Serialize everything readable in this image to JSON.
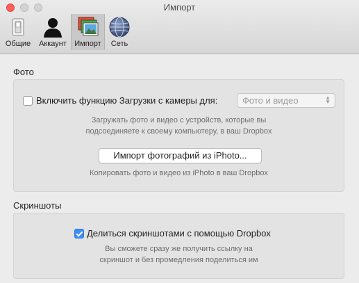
{
  "window": {
    "title": "Импорт"
  },
  "toolbar": {
    "tabs": [
      {
        "label": "Общие",
        "icon": "switch-icon",
        "selected": false
      },
      {
        "label": "Аккаунт",
        "icon": "user-silhouette-icon",
        "selected": false
      },
      {
        "label": "Импорт",
        "icon": "photos-stack-icon",
        "selected": true
      },
      {
        "label": "Сеть",
        "icon": "globe-icon",
        "selected": false
      }
    ]
  },
  "photos_section": {
    "title": "Фото",
    "camera_upload": {
      "checked": false,
      "label": "Включить функцию Загрузки с камеры для:",
      "select_value": "Фото и видео",
      "hint_line1": "Загружать фото и видео с устройств, которые вы",
      "hint_line2": "подсоединяете к своему компьютеру, в ваш Dropbox"
    },
    "iphoto": {
      "button_label": "Импорт фотографий из iPhoto...",
      "hint": "Копировать фото и видео из iPhoto в ваш Dropbox"
    }
  },
  "screenshots_section": {
    "title": "Скриншоты",
    "share": {
      "checked": true,
      "label": "Делиться скриншотами с помощью Dropbox",
      "hint_line1": "Вы сможете сразу же получить ссылку на",
      "hint_line2": "скриншот и без промедления поделиться им"
    }
  },
  "colors": {
    "accent": "#3c8ef6",
    "close": "#fc605c"
  }
}
